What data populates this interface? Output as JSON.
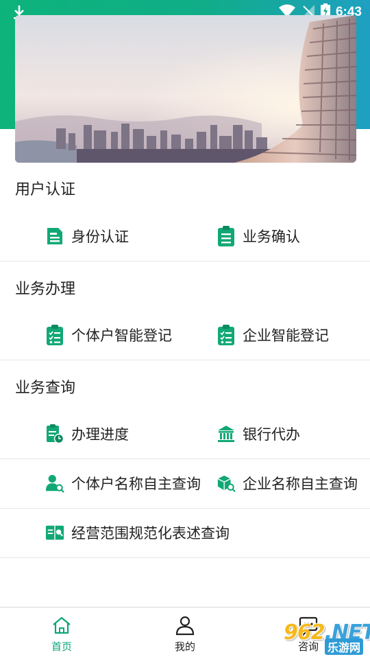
{
  "status_bar": {
    "time": "6:43",
    "icons": [
      "download-icon",
      "wifi-icon",
      "no-signal-icon",
      "battery-charging-icon"
    ]
  },
  "banner": {
    "description_icon": "city-skyline-image"
  },
  "sections": [
    {
      "title": "用户认证",
      "items": [
        {
          "label": "身份认证",
          "icon": "id-card-icon"
        },
        {
          "label": "业务确认",
          "icon": "clipboard-list-icon"
        }
      ]
    },
    {
      "title": "业务办理",
      "items": [
        {
          "label": "个体户智能登记",
          "icon": "checklist-icon"
        },
        {
          "label": "企业智能登记",
          "icon": "checklist-icon"
        }
      ]
    },
    {
      "title": "业务查询",
      "items": [
        {
          "label": "办理进度",
          "icon": "progress-clock-icon"
        },
        {
          "label": "银行代办",
          "icon": "bank-icon"
        },
        {
          "label": "个体户名称自主查询",
          "icon": "person-search-icon"
        },
        {
          "label": "企业名称自主查询",
          "icon": "building-search-icon"
        },
        {
          "label": "经营范围规范化表述查询",
          "icon": "book-search-icon"
        }
      ]
    }
  ],
  "tabbar": [
    {
      "label": "首页",
      "icon": "home-icon",
      "active": true
    },
    {
      "label": "我的",
      "icon": "user-icon",
      "active": false
    },
    {
      "label": "咨询",
      "icon": "chat-icon",
      "active": false
    }
  ],
  "watermark": {
    "number": "962",
    "suffix": ".NET",
    "sub": "乐游网"
  },
  "colors": {
    "accent": "#0aa57a",
    "header_gradient_start": "#0db37a",
    "header_gradient_end": "#1fa0c2",
    "icon_green": "#12a876"
  }
}
